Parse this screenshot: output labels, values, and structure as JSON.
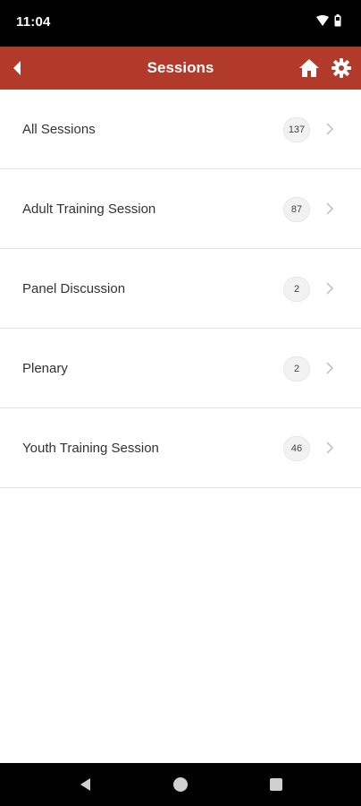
{
  "status_bar": {
    "time": "11:04",
    "icons": [
      "wifi-icon",
      "battery-icon"
    ]
  },
  "app_bar": {
    "title": "Sessions",
    "background_color": "#b23a2a",
    "icons": [
      "back-arrow-icon",
      "home-icon",
      "gear-icon"
    ]
  },
  "sessions": [
    {
      "label": "All Sessions",
      "count": "137"
    },
    {
      "label": "Adult Training Session",
      "count": "87"
    },
    {
      "label": "Panel Discussion",
      "count": "2"
    },
    {
      "label": "Plenary",
      "count": "2"
    },
    {
      "label": "Youth Training Session",
      "count": "46"
    }
  ],
  "nav_bar": {
    "icons": [
      "back-triangle-icon",
      "home-circle-icon",
      "recents-square-icon"
    ]
  }
}
